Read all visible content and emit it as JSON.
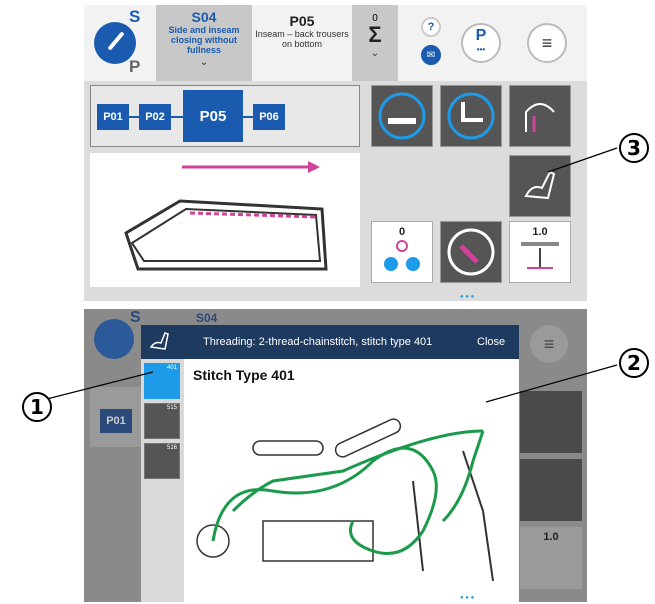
{
  "top_screen": {
    "mode": {
      "s_label": "S",
      "p_label": "P"
    },
    "sequence": {
      "code": "S04",
      "lines": [
        "Side and inseam",
        "closing without",
        "fullness"
      ]
    },
    "program": {
      "code": "P05",
      "lines": [
        "Inseam – back trousers",
        "on bottom"
      ]
    },
    "counter": {
      "value": "0",
      "symbol": "Σ"
    },
    "help": "?",
    "p_button": {
      "label": "P",
      "dots": "•••"
    },
    "menu_icon": "≡",
    "program_chain": [
      "P01",
      "P02",
      "P05",
      "P06"
    ],
    "tiles": {
      "thread_counter": "0",
      "stitch_length": "1.0"
    }
  },
  "bottom_screen": {
    "behind": {
      "s_label": "S",
      "seq_code": "S04",
      "chip": "P01",
      "stitch_length": "1.0"
    },
    "dialog": {
      "title": "Threading: 2-thread-chainstitch, stitch type 401",
      "close": "Close",
      "thumbnails": [
        {
          "label": "401",
          "selected": true
        },
        {
          "label": "515",
          "selected": false
        },
        {
          "label": "516",
          "selected": false
        }
      ],
      "content_title": "Stitch Type 401"
    }
  },
  "callouts": {
    "one": "1",
    "two": "2",
    "three": "3"
  },
  "colors": {
    "accent_blue": "#1a5bb0",
    "dialog_header": "#1e3a5f",
    "thread_green": "#1a9a4a",
    "magenta": "#d0439a"
  }
}
